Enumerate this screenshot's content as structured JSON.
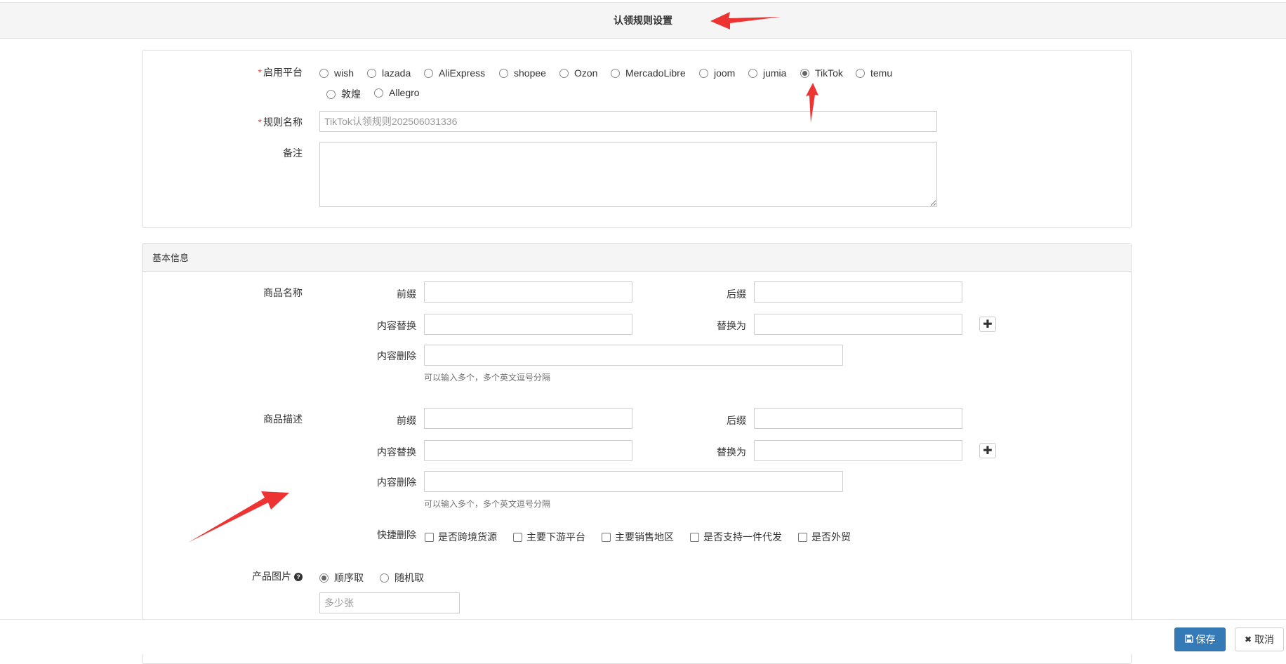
{
  "header": {
    "title": "认领规则设置"
  },
  "rule_form": {
    "platform_label": "启用平台",
    "platforms": [
      {
        "label": "wish",
        "checked": false
      },
      {
        "label": "lazada",
        "checked": false
      },
      {
        "label": "AliExpress",
        "checked": false
      },
      {
        "label": "shopee",
        "checked": false
      },
      {
        "label": "Ozon",
        "checked": false
      },
      {
        "label": "MercadoLibre",
        "checked": false
      },
      {
        "label": "joom",
        "checked": false
      },
      {
        "label": "jumia",
        "checked": false
      },
      {
        "label": "TikTok",
        "checked": true
      },
      {
        "label": "temu",
        "checked": false
      },
      {
        "label": "敦煌",
        "checked": false
      },
      {
        "label": "Allegro",
        "checked": false
      }
    ],
    "rule_name_label": "规则名称",
    "rule_name_value": "TikTok认领规则202506031336",
    "remark_label": "备注",
    "remark_value": ""
  },
  "basic_info": {
    "heading": "基本信息",
    "product_name": {
      "label": "商品名称",
      "prefix_label": "前缀",
      "suffix_label": "后缀",
      "replace_label": "内容替换",
      "replace_with_label": "替换为",
      "delete_label": "内容删除",
      "delete_help": "可以输入多个，多个英文逗号分隔"
    },
    "product_desc": {
      "label": "商品描述",
      "prefix_label": "前缀",
      "suffix_label": "后缀",
      "replace_label": "内容替换",
      "replace_with_label": "替换为",
      "delete_label": "内容删除",
      "delete_help": "可以输入多个，多个英文逗号分隔",
      "quick_delete_label": "快捷删除",
      "quick_delete_options": [
        {
          "label": "是否跨境货源",
          "checked": false
        },
        {
          "label": "主要下游平台",
          "checked": false
        },
        {
          "label": "主要销售地区",
          "checked": false
        },
        {
          "label": "是否支持一件代发",
          "checked": false
        },
        {
          "label": "是否外贸",
          "checked": false
        }
      ]
    },
    "product_images": {
      "label": "产品图片",
      "options": [
        {
          "label": "顺序取",
          "checked": true
        },
        {
          "label": "随机取",
          "checked": false
        }
      ],
      "count_placeholder": "多少张"
    }
  },
  "footer": {
    "save_label": "保存",
    "cancel_label": "取消"
  },
  "colors": {
    "primary": "#337ab7",
    "required": "#d9534f",
    "annotation_arrow": "#ee3333"
  }
}
